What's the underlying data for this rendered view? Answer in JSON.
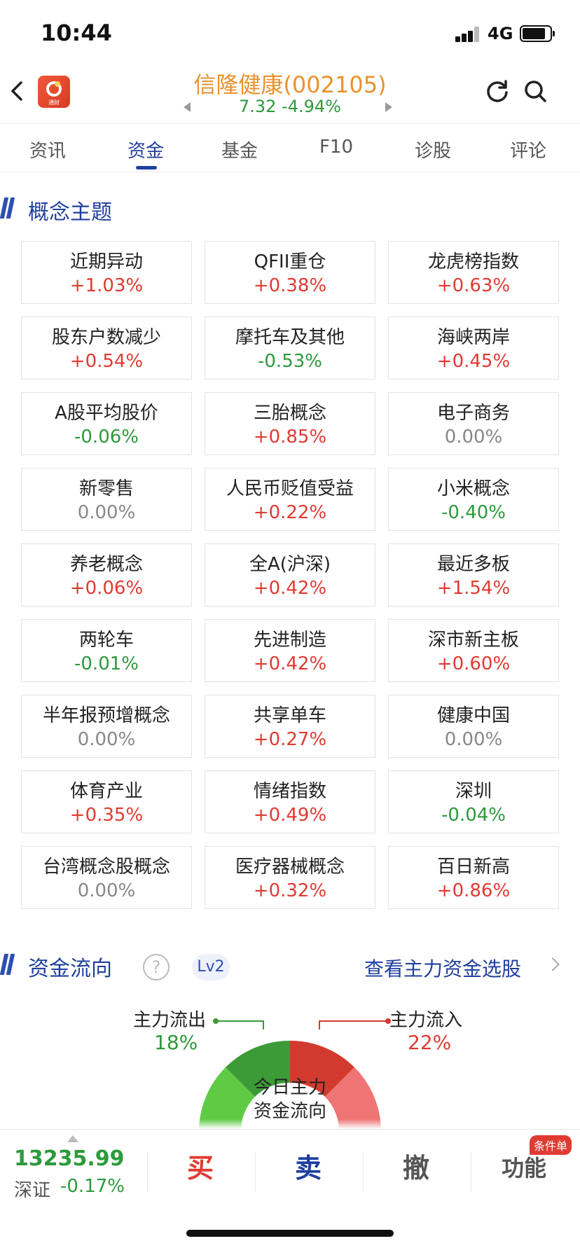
{
  "status_bar": {
    "time": "10:44",
    "network": "4G"
  },
  "header": {
    "stock_title": "信隆健康(002105)",
    "price_line": "7.32 -4.94%",
    "app_logo_text": "通财",
    "colors": {
      "title": "#e8922e",
      "price": "#2d9a3c"
    }
  },
  "tabs": [
    {
      "label": "资讯",
      "active": false
    },
    {
      "label": "资金",
      "active": true
    },
    {
      "label": "基金",
      "active": false
    },
    {
      "label": "F10",
      "active": false
    },
    {
      "label": "诊股",
      "active": false
    },
    {
      "label": "评论",
      "active": false
    }
  ],
  "concepts": {
    "title": "概念主题",
    "items": [
      {
        "name": "近期异动",
        "change": "+1.03%",
        "dir": "up"
      },
      {
        "name": "QFII重仓",
        "change": "+0.38%",
        "dir": "up"
      },
      {
        "name": "龙虎榜指数",
        "change": "+0.63%",
        "dir": "up"
      },
      {
        "name": "股东户数减少",
        "change": "+0.54%",
        "dir": "up"
      },
      {
        "name": "摩托车及其他",
        "change": "-0.53%",
        "dir": "down"
      },
      {
        "name": "海峡两岸",
        "change": "+0.45%",
        "dir": "up"
      },
      {
        "name": "A股平均股价",
        "change": "-0.06%",
        "dir": "down"
      },
      {
        "name": "三胎概念",
        "change": "+0.85%",
        "dir": "up"
      },
      {
        "name": "电子商务",
        "change": "0.00%",
        "dir": "flat"
      },
      {
        "name": "新零售",
        "change": "0.00%",
        "dir": "flat"
      },
      {
        "name": "人民币贬值受益",
        "change": "+0.22%",
        "dir": "up"
      },
      {
        "name": "小米概念",
        "change": "-0.40%",
        "dir": "down"
      },
      {
        "name": "养老概念",
        "change": "+0.06%",
        "dir": "up"
      },
      {
        "name": "全A(沪深)",
        "change": "+0.42%",
        "dir": "up"
      },
      {
        "name": "最近多板",
        "change": "+1.54%",
        "dir": "up"
      },
      {
        "name": "两轮车",
        "change": "-0.01%",
        "dir": "down"
      },
      {
        "name": "先进制造",
        "change": "+0.42%",
        "dir": "up"
      },
      {
        "name": "深市新主板",
        "change": "+0.60%",
        "dir": "up"
      },
      {
        "name": "半年报预增概念",
        "change": "0.00%",
        "dir": "flat"
      },
      {
        "name": "共享单车",
        "change": "+0.27%",
        "dir": "up"
      },
      {
        "name": "健康中国",
        "change": "0.00%",
        "dir": "flat"
      },
      {
        "name": "体育产业",
        "change": "+0.35%",
        "dir": "up"
      },
      {
        "name": "情绪指数",
        "change": "+0.49%",
        "dir": "up"
      },
      {
        "name": "深圳",
        "change": "-0.04%",
        "dir": "down"
      },
      {
        "name": "台湾概念股概念",
        "change": "0.00%",
        "dir": "flat"
      },
      {
        "name": "医疗器械概念",
        "change": "+0.32%",
        "dir": "up"
      },
      {
        "name": "百日新高",
        "change": "+0.86%",
        "dir": "up"
      }
    ]
  },
  "fund_flow": {
    "title": "资金流向",
    "help": "?",
    "level_badge": "Lv2",
    "link": "查看主力资金选股",
    "out_label": "主力流出",
    "out_pct": "18%",
    "in_label": "主力流入",
    "in_pct": "22%",
    "center_line1": "今日主力",
    "center_line2": "资金流向",
    "colors": {
      "main_out": "#3c9a37",
      "retail_out": "#5fcb45",
      "main_in": "#d33a2f",
      "retail_in": "#ef7474"
    }
  },
  "bottom_bar": {
    "index_value": "13235.99",
    "index_name": "深证",
    "index_change": "-0.17%",
    "buy": "买",
    "sell": "卖",
    "cancel": "撤",
    "function": "功能",
    "badge": "条件单"
  }
}
